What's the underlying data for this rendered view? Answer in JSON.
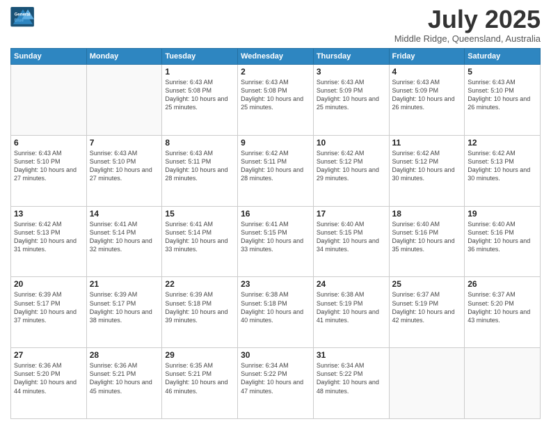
{
  "logo": {
    "line1": "General",
    "line2": "Blue"
  },
  "title": "July 2025",
  "location": "Middle Ridge, Queensland, Australia",
  "days_header": [
    "Sunday",
    "Monday",
    "Tuesday",
    "Wednesday",
    "Thursday",
    "Friday",
    "Saturday"
  ],
  "weeks": [
    [
      {
        "day": "",
        "info": ""
      },
      {
        "day": "",
        "info": ""
      },
      {
        "day": "1",
        "info": "Sunrise: 6:43 AM\nSunset: 5:08 PM\nDaylight: 10 hours and 25 minutes."
      },
      {
        "day": "2",
        "info": "Sunrise: 6:43 AM\nSunset: 5:08 PM\nDaylight: 10 hours and 25 minutes."
      },
      {
        "day": "3",
        "info": "Sunrise: 6:43 AM\nSunset: 5:09 PM\nDaylight: 10 hours and 25 minutes."
      },
      {
        "day": "4",
        "info": "Sunrise: 6:43 AM\nSunset: 5:09 PM\nDaylight: 10 hours and 26 minutes."
      },
      {
        "day": "5",
        "info": "Sunrise: 6:43 AM\nSunset: 5:10 PM\nDaylight: 10 hours and 26 minutes."
      }
    ],
    [
      {
        "day": "6",
        "info": "Sunrise: 6:43 AM\nSunset: 5:10 PM\nDaylight: 10 hours and 27 minutes."
      },
      {
        "day": "7",
        "info": "Sunrise: 6:43 AM\nSunset: 5:10 PM\nDaylight: 10 hours and 27 minutes."
      },
      {
        "day": "8",
        "info": "Sunrise: 6:43 AM\nSunset: 5:11 PM\nDaylight: 10 hours and 28 minutes."
      },
      {
        "day": "9",
        "info": "Sunrise: 6:42 AM\nSunset: 5:11 PM\nDaylight: 10 hours and 28 minutes."
      },
      {
        "day": "10",
        "info": "Sunrise: 6:42 AM\nSunset: 5:12 PM\nDaylight: 10 hours and 29 minutes."
      },
      {
        "day": "11",
        "info": "Sunrise: 6:42 AM\nSunset: 5:12 PM\nDaylight: 10 hours and 30 minutes."
      },
      {
        "day": "12",
        "info": "Sunrise: 6:42 AM\nSunset: 5:13 PM\nDaylight: 10 hours and 30 minutes."
      }
    ],
    [
      {
        "day": "13",
        "info": "Sunrise: 6:42 AM\nSunset: 5:13 PM\nDaylight: 10 hours and 31 minutes."
      },
      {
        "day": "14",
        "info": "Sunrise: 6:41 AM\nSunset: 5:14 PM\nDaylight: 10 hours and 32 minutes."
      },
      {
        "day": "15",
        "info": "Sunrise: 6:41 AM\nSunset: 5:14 PM\nDaylight: 10 hours and 33 minutes."
      },
      {
        "day": "16",
        "info": "Sunrise: 6:41 AM\nSunset: 5:15 PM\nDaylight: 10 hours and 33 minutes."
      },
      {
        "day": "17",
        "info": "Sunrise: 6:40 AM\nSunset: 5:15 PM\nDaylight: 10 hours and 34 minutes."
      },
      {
        "day": "18",
        "info": "Sunrise: 6:40 AM\nSunset: 5:16 PM\nDaylight: 10 hours and 35 minutes."
      },
      {
        "day": "19",
        "info": "Sunrise: 6:40 AM\nSunset: 5:16 PM\nDaylight: 10 hours and 36 minutes."
      }
    ],
    [
      {
        "day": "20",
        "info": "Sunrise: 6:39 AM\nSunset: 5:17 PM\nDaylight: 10 hours and 37 minutes."
      },
      {
        "day": "21",
        "info": "Sunrise: 6:39 AM\nSunset: 5:17 PM\nDaylight: 10 hours and 38 minutes."
      },
      {
        "day": "22",
        "info": "Sunrise: 6:39 AM\nSunset: 5:18 PM\nDaylight: 10 hours and 39 minutes."
      },
      {
        "day": "23",
        "info": "Sunrise: 6:38 AM\nSunset: 5:18 PM\nDaylight: 10 hours and 40 minutes."
      },
      {
        "day": "24",
        "info": "Sunrise: 6:38 AM\nSunset: 5:19 PM\nDaylight: 10 hours and 41 minutes."
      },
      {
        "day": "25",
        "info": "Sunrise: 6:37 AM\nSunset: 5:19 PM\nDaylight: 10 hours and 42 minutes."
      },
      {
        "day": "26",
        "info": "Sunrise: 6:37 AM\nSunset: 5:20 PM\nDaylight: 10 hours and 43 minutes."
      }
    ],
    [
      {
        "day": "27",
        "info": "Sunrise: 6:36 AM\nSunset: 5:20 PM\nDaylight: 10 hours and 44 minutes."
      },
      {
        "day": "28",
        "info": "Sunrise: 6:36 AM\nSunset: 5:21 PM\nDaylight: 10 hours and 45 minutes."
      },
      {
        "day": "29",
        "info": "Sunrise: 6:35 AM\nSunset: 5:21 PM\nDaylight: 10 hours and 46 minutes."
      },
      {
        "day": "30",
        "info": "Sunrise: 6:34 AM\nSunset: 5:22 PM\nDaylight: 10 hours and 47 minutes."
      },
      {
        "day": "31",
        "info": "Sunrise: 6:34 AM\nSunset: 5:22 PM\nDaylight: 10 hours and 48 minutes."
      },
      {
        "day": "",
        "info": ""
      },
      {
        "day": "",
        "info": ""
      }
    ]
  ]
}
